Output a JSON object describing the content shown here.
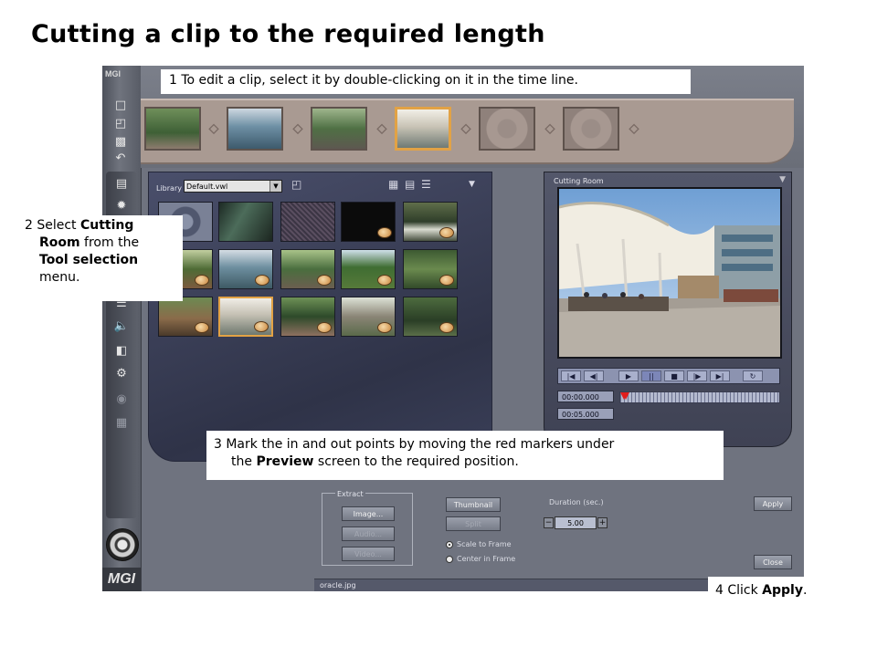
{
  "page": {
    "title": "Cutting a clip to the required length"
  },
  "callouts": {
    "step1": {
      "text": "1  To edit a clip, select it by double-clicking on it in the time line."
    },
    "step2": {
      "num": "2  Select ",
      "bold1": "Cutting Room",
      "mid1": " from the ",
      "bold2": "Tool selection",
      "end": " menu.",
      "line1a": "2  Select ",
      "line1b": "Cutting",
      "line2a": "Room",
      "line2b": " from the",
      "line3": "Tool selection",
      "line4": "menu."
    },
    "step3": {
      "line1": "3  Mark the in and out points by moving the red markers under",
      "line2a": "the ",
      "line2b": "Preview",
      "line2c": " screen to the required position."
    },
    "step4": {
      "a": "4  Click ",
      "b": "Apply",
      "c": "."
    }
  },
  "app": {
    "brand_top": "MGI",
    "brand_bottom": "MGI",
    "toolbar_icons": [
      "new-file-icon",
      "open-folder-icon",
      "save-disk-icon",
      "undo-icon"
    ],
    "tool_icons": [
      "film-icon",
      "effects-icon",
      "tools-icon",
      "audio-icon",
      "overlay-icon",
      "plug-icon",
      "globe-icon",
      "export-icon"
    ],
    "library": {
      "label": "Library",
      "selected_file": "Default.vwl"
    },
    "cutting_room": {
      "title": "Cutting Room",
      "timecode_in": "00:00.000",
      "timecode_out": "00:05.000",
      "transport_icons": [
        "go-start-icon",
        "step-back-icon",
        "play-icon",
        "pause-icon",
        "stop-icon",
        "step-forward-icon",
        "go-end-icon",
        "loop-icon"
      ]
    },
    "controls": {
      "extract_label": "Extract",
      "image_button": "Image...",
      "audio_button": "Audio...",
      "video_button": "Video...",
      "thumbnail_button": "Thumbnail",
      "split_button": "Split",
      "duration_label": "Duration (sec.)",
      "duration_value": "5.00",
      "minus": "−",
      "plus": "+",
      "scale_to_frame": "Scale to Frame",
      "center_in_frame": "Center in Frame",
      "apply_button": "Apply",
      "close_button": "Close"
    },
    "status": {
      "filename": "oracle.jpg"
    }
  }
}
